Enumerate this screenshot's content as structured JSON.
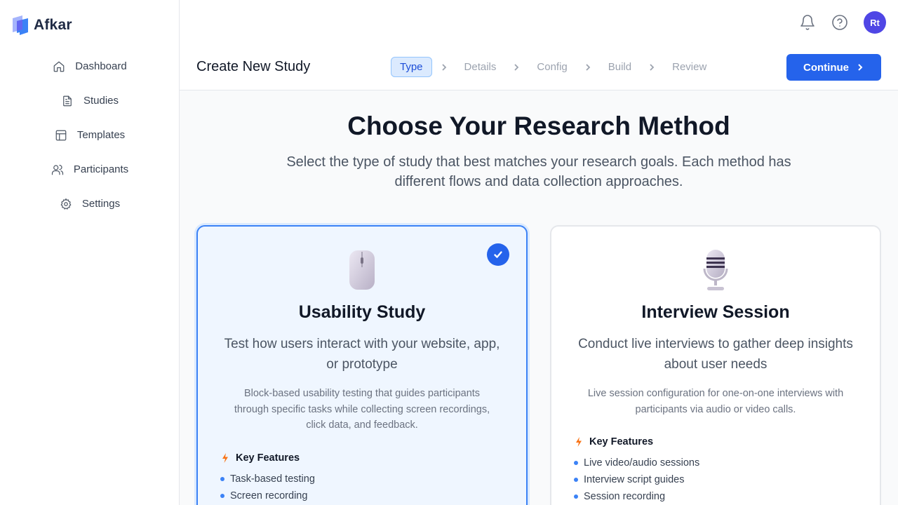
{
  "app": {
    "name": "Afkar"
  },
  "sidebar": {
    "items": [
      {
        "label": "Dashboard",
        "icon": "home-icon"
      },
      {
        "label": "Studies",
        "icon": "document-icon"
      },
      {
        "label": "Templates",
        "icon": "template-icon"
      },
      {
        "label": "Participants",
        "icon": "users-icon"
      },
      {
        "label": "Settings",
        "icon": "gear-icon"
      }
    ]
  },
  "topbar": {
    "avatar_initials": "Rt"
  },
  "header": {
    "title": "Create New Study",
    "steps": [
      "Type",
      "Details",
      "Config",
      "Build",
      "Review"
    ],
    "active_step": "Type",
    "continue_label": "Continue"
  },
  "main": {
    "heading": "Choose Your Research Method",
    "subheading": "Select the type of study that best matches your research goals. Each method has different flows and data collection approaches."
  },
  "cards": [
    {
      "title": "Usability Study",
      "subtitle": "Test how users interact with your website, app, or prototype",
      "description": "Block-based usability testing that guides participants through specific tasks while collecting screen recordings, click data, and feedback.",
      "features_label": "Key Features",
      "features": [
        "Task-based testing",
        "Screen recording"
      ],
      "selected": true,
      "icon": "mouse-icon"
    },
    {
      "title": "Interview Session",
      "subtitle": "Conduct live interviews to gather deep insights about user needs",
      "description": "Live session configuration for one-on-one interviews with participants via audio or video calls.",
      "features_label": "Key Features",
      "features": [
        "Live video/audio sessions",
        "Interview script guides",
        "Session recording"
      ],
      "selected": false,
      "icon": "microphone-icon"
    }
  ],
  "colors": {
    "primary": "#2563eb",
    "avatar": "#4f46e5",
    "selected_bg": "#eff6ff",
    "bolt": "#f97316"
  }
}
